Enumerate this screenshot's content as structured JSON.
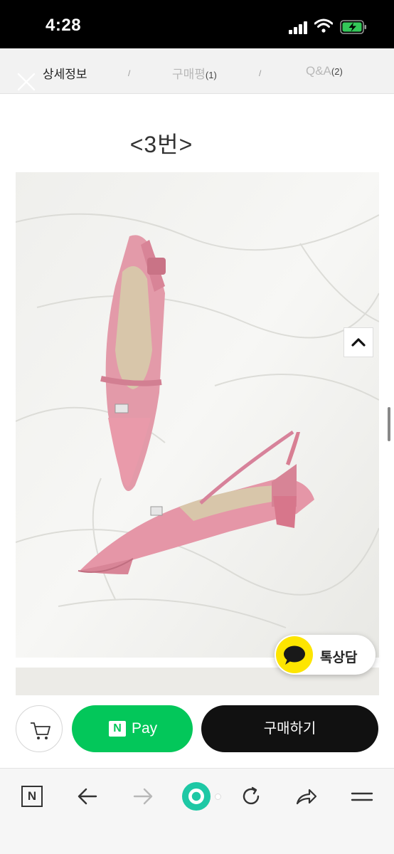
{
  "status_bar": {
    "time": "4:28"
  },
  "tabs": [
    {
      "label": "상세정보",
      "count": ""
    },
    {
      "label": "구매평",
      "count": "(1)"
    },
    {
      "label": "Q&A",
      "count": "(2)"
    }
  ],
  "tab_separator": "/",
  "content": {
    "heading": "<3번>"
  },
  "kakao": {
    "label": "톡상담"
  },
  "purchase": {
    "npay_logo": "N",
    "npay_label": "Pay",
    "buy_label": "구매하기"
  },
  "toolbar": {
    "naver_label": "N"
  },
  "colors": {
    "npay_green": "#03c75a",
    "buy_black": "#111111",
    "kakao_yellow": "#fde500"
  },
  "icons": [
    "close-icon",
    "chevron-up-icon",
    "kakao-chat-icon",
    "cart-icon",
    "arrow-left-icon",
    "arrow-right-icon",
    "home-icon",
    "reload-icon",
    "share-icon",
    "menu-icon"
  ]
}
